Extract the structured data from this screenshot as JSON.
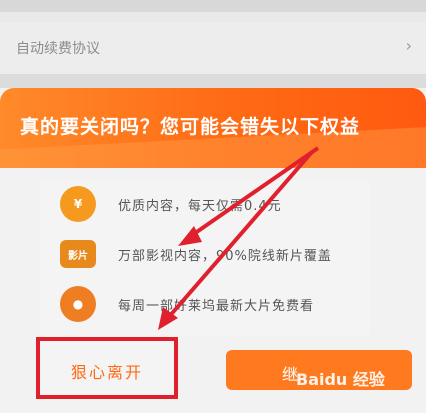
{
  "background_row": {
    "label": "自动续费协议",
    "chevron": "›"
  },
  "dialog": {
    "banner_title": "真的要关闭吗？您可能会错失以下权益",
    "benefits": [
      {
        "icon": "coin-stack-icon",
        "icon_text": "¥",
        "text": "优质内容，每天仅需0.4元"
      },
      {
        "icon": "film-ticket-icon",
        "icon_text": "影片",
        "text": "万部影视内容，90%院线新片覆盖"
      },
      {
        "icon": "film-reel-icon",
        "icon_text": "●",
        "text": "每周一部好莱坞最新大片免费看"
      }
    ],
    "leave_label": "狠心离开",
    "continue_label": "继"
  },
  "watermark": "Baidu 经验",
  "colors": {
    "accent": "#ff6a14",
    "highlight": "#e1202e"
  }
}
